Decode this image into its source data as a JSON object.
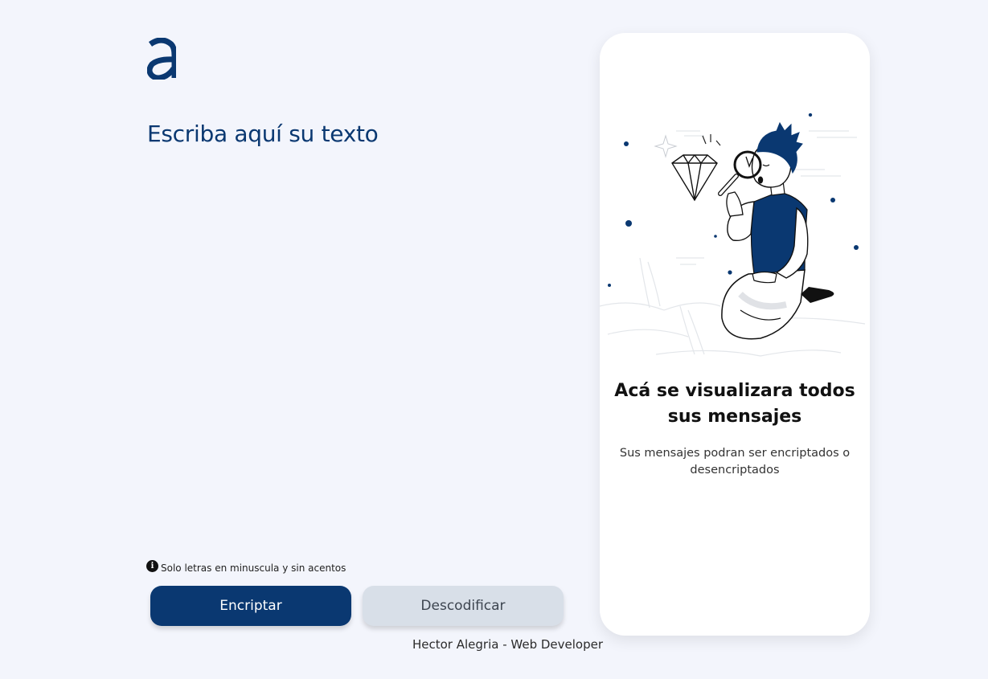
{
  "logo": {
    "icon": "alura-a-logo-icon",
    "color": "#0a3871"
  },
  "input": {
    "placeholder": "Escriba aquí su texto",
    "value": ""
  },
  "hint": {
    "icon": "info-icon",
    "text": "Solo letras en minuscula y sin acentos"
  },
  "buttons": {
    "encrypt": "Encriptar",
    "decrypt": "Descodificar"
  },
  "output": {
    "illustration": "person-with-magnifying-glass-illustration",
    "title": "Acá se visualizara todos sus mensajes",
    "subtitle": "Sus mensajes podran ser encriptados o desencriptados"
  },
  "footer": {
    "text": "Hector Alegria - Web Developer"
  },
  "colors": {
    "accent": "#0a3871",
    "background": "#f3f5fc",
    "secondary_button": "#d8dfe8"
  }
}
